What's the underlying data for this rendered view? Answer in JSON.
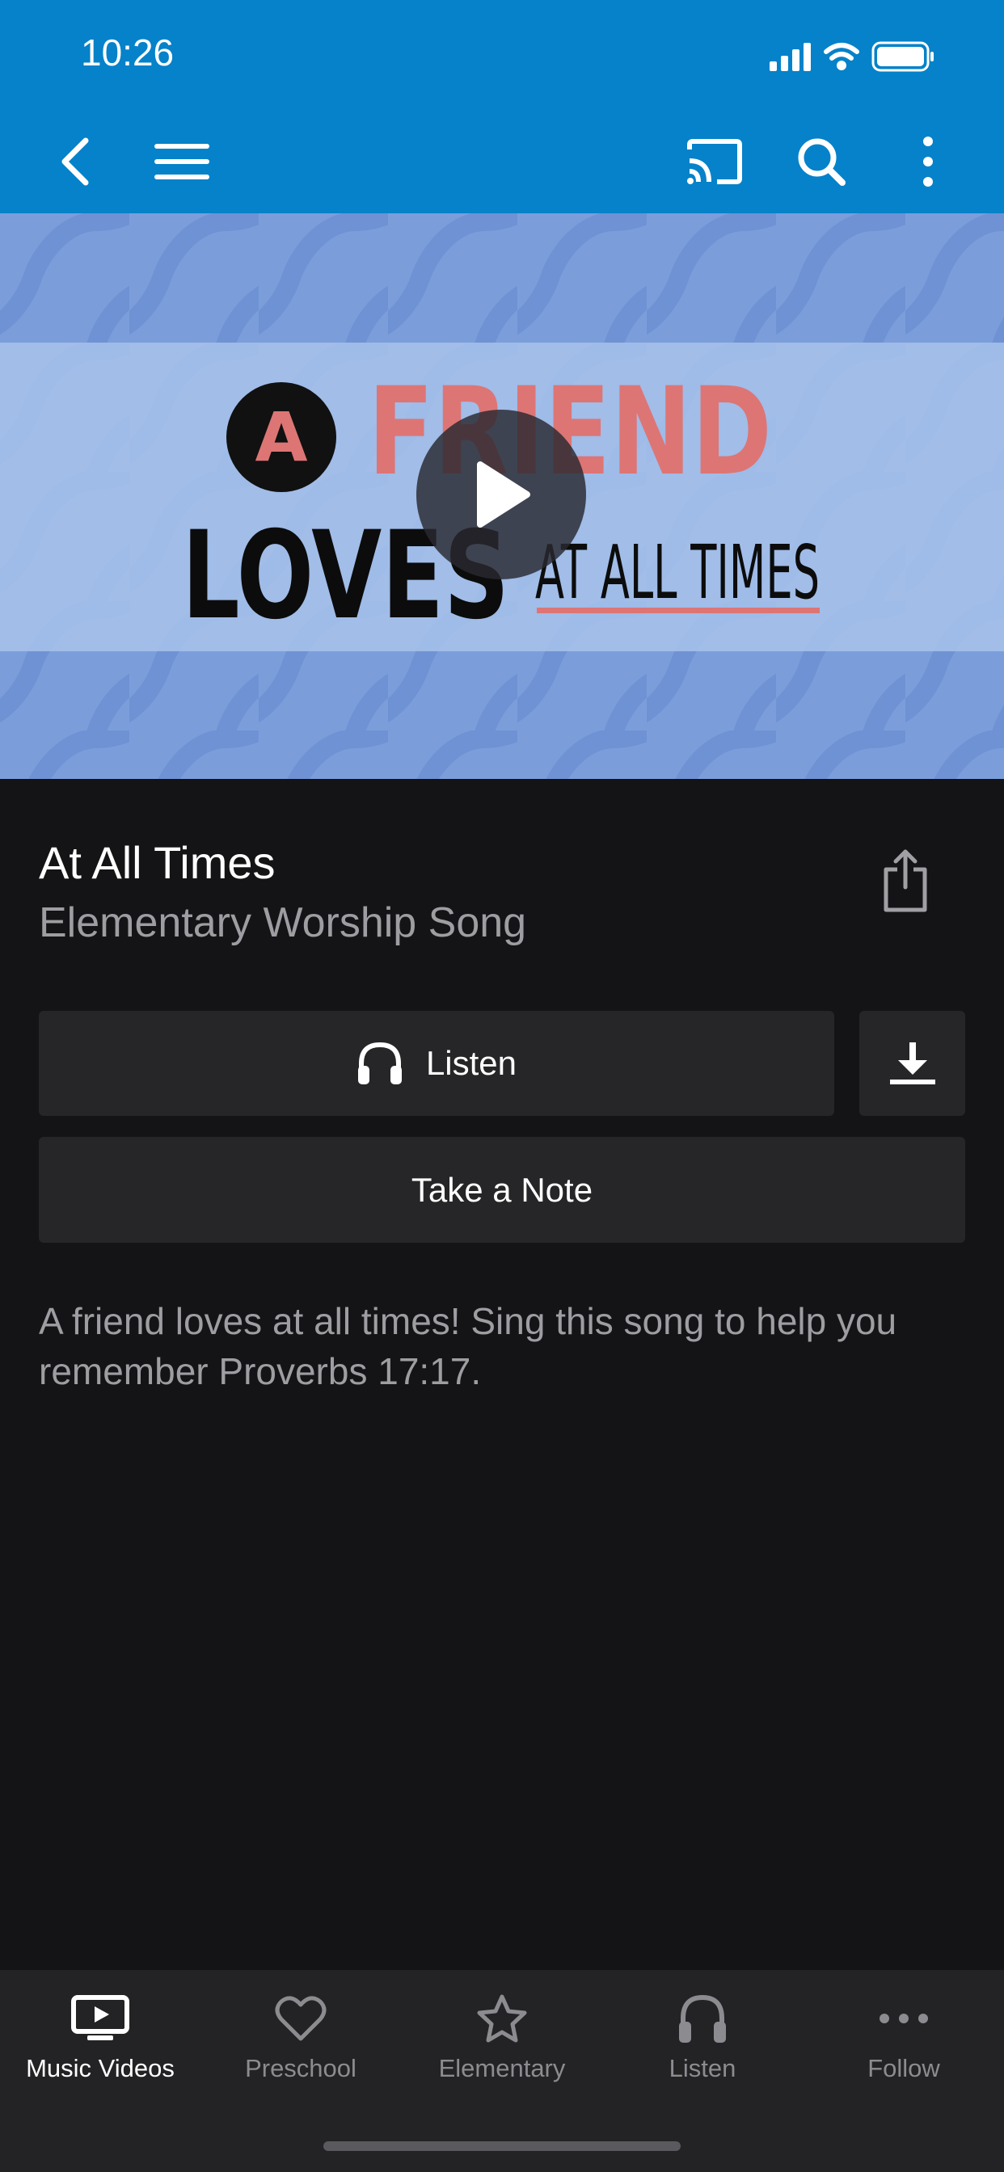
{
  "status_bar": {
    "time": "10:26"
  },
  "toolbar": {
    "icons": [
      "back-icon",
      "menu-icon",
      "cast-icon",
      "search-icon",
      "more-vertical-icon"
    ]
  },
  "video": {
    "artwork_text": {
      "a": "A",
      "friend": "FRIEND",
      "loves": "LOVES",
      "at_all_times": "AT ALL TIMES"
    }
  },
  "song": {
    "title": "At All Times",
    "subtitle": "Elementary Worship Song",
    "description": "A friend loves at all times! Sing this song to help you remember Proverbs 17:17."
  },
  "actions": {
    "listen_label": "Listen",
    "take_note_label": "Take a Note"
  },
  "tabs": [
    {
      "label": "Music Videos",
      "icon": "tv-play-icon",
      "active": true
    },
    {
      "label": "Preschool",
      "icon": "heart-icon",
      "active": false
    },
    {
      "label": "Elementary",
      "icon": "star-icon",
      "active": false
    },
    {
      "label": "Listen",
      "icon": "headphones-icon",
      "active": false
    },
    {
      "label": "Follow",
      "icon": "more-horizontal-icon",
      "active": false
    }
  ],
  "colors": {
    "header": "#0582c9",
    "background": "#141416",
    "button": "#262628",
    "artwork_blue": "#7b9edb",
    "artwork_light": "#a8c2ea",
    "artwork_accent": "#dd7575"
  }
}
